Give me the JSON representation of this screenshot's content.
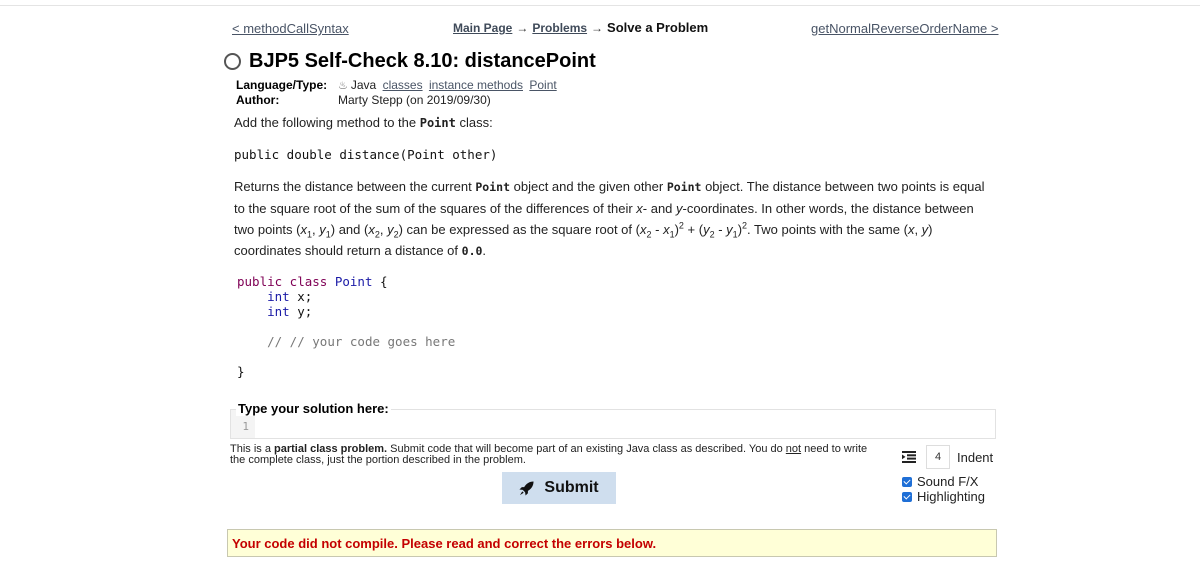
{
  "nav": {
    "prev_label": "< methodCallSyntax",
    "breadcrumbs": [
      "Main Page",
      "Problems"
    ],
    "arrow": "→",
    "current": "Solve a Problem",
    "next_label": "getNormalReverseOrderName >"
  },
  "problem": {
    "title": "BJP5 Self-Check 8.10: distancePoint",
    "language_type_label": "Language/Type:",
    "language": "Java",
    "tags": [
      "classes",
      "instance methods",
      "Point"
    ],
    "author_label": "Author:",
    "author": "Marty Stepp (on 2019/09/30)"
  },
  "description": {
    "intro_before": "Add the following method to the ",
    "intro_code": "Point",
    "intro_after": " class:",
    "signature": "public double distance(Point other)",
    "p1_a": "Returns the distance between the current ",
    "p1_code1": "Point",
    "p1_b": " object and the given other ",
    "p1_code2": "Point",
    "p1_c": " object. The distance between two points is equal to the square root of the sum of the squares of the differences of their ",
    "p1_x": "x",
    "p1_d": "- and ",
    "p1_y": "y",
    "p1_e": "-coordinates. In other words, the distance between two points (",
    "formula": {
      "x": "x",
      "y": "y",
      "one": "1",
      "two": "2",
      "sq": "2"
    },
    "p1_f": " can be expressed as the square root of ",
    "p1_g": ". Two points with the same (",
    "p1_h": ") coordinates should return a distance of ",
    "zero_code": "0.0",
    "p1_end": "."
  },
  "code_template": {
    "line1_kw": "public class",
    "line1_cls": "Point",
    "line1_brace": "{",
    "field1_type": "int",
    "field1_name": "x;",
    "field2_type": "int",
    "field2_name": "y;",
    "comment": "// // your code goes here",
    "close_brace": "}"
  },
  "solution": {
    "legend": "Type your solution here:",
    "line_number": "1",
    "code": ""
  },
  "partial_note": {
    "a": "This is a ",
    "bold": "partial class problem.",
    "b": " Submit code that will become part of an existing Java class as described. You do ",
    "underline": "not",
    "c": " need to write the complete class, just the portion described in the problem."
  },
  "settings": {
    "indent_value": "4",
    "indent_label": "Indent",
    "options": [
      {
        "label": "Sound F/X",
        "checked": true
      },
      {
        "label": "Highlighting",
        "checked": true
      }
    ]
  },
  "submit_label": "Submit",
  "error_message": "Your code did not compile. Please read and correct the errors below.",
  "colors": {
    "error_text": "#c40000",
    "error_bg": "#ffffd7",
    "submit_bg": "#cfdeee",
    "checkbox": "#1f6fd6"
  }
}
